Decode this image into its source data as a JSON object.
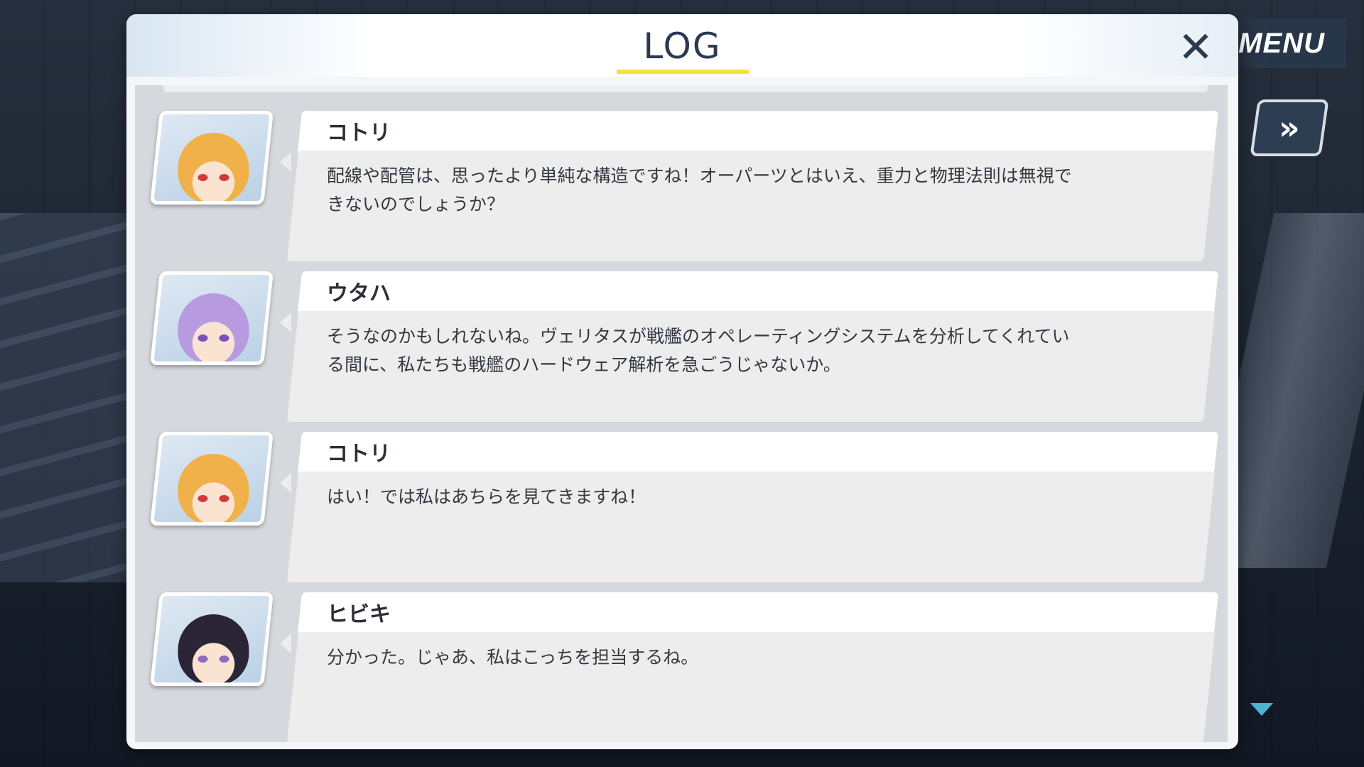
{
  "menu": {
    "label": "MENU"
  },
  "fast_forward": {
    "label": "»"
  },
  "log": {
    "title": "LOG",
    "close_label": "✕",
    "entries": [
      {
        "speaker": "コトリ",
        "text": "配線や配管は、思ったより単純な構造ですね！オーパーツとはいえ、重力と物理法則は無視できないのでしょうか？",
        "hair_color": "#f0b04a",
        "accent_color": "#d23a3a"
      },
      {
        "speaker": "ウタハ",
        "text": "そうなのかもしれないね。ヴェリタスが戦艦のオペレーティングシステムを分析してくれている間に、私たちも戦艦のハードウェア解析を急ごうじゃないか。",
        "hair_color": "#b79ae0",
        "accent_color": "#7a4fc0"
      },
      {
        "speaker": "コトリ",
        "text": "はい！では私はあちらを見てきますね！",
        "hair_color": "#f0b04a",
        "accent_color": "#d23a3a"
      },
      {
        "speaker": "ヒビキ",
        "text": "分かった。じゃあ、私はこっちを担当するね。",
        "hair_color": "#2a2436",
        "accent_color": "#8a6bc0"
      }
    ]
  }
}
